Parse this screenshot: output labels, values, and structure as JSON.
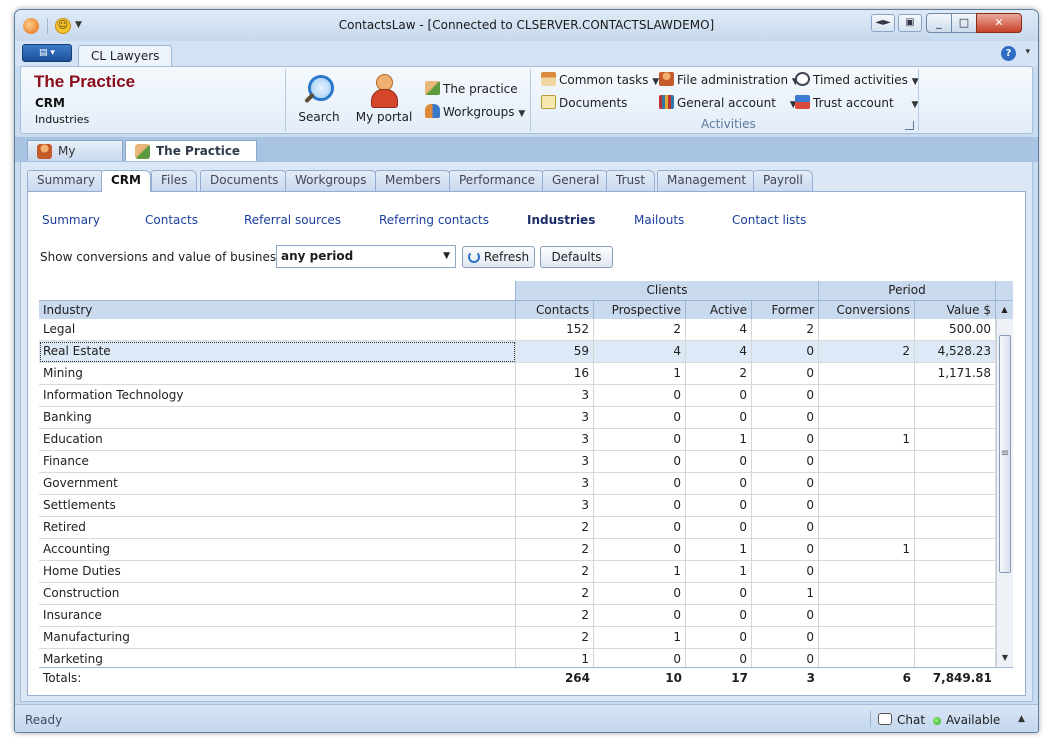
{
  "window": {
    "title": "ContactsLaw - [Connected to CLSERVER.CONTACTSLAWDEMO]"
  },
  "ribbon_tabs": {
    "active": "CL Lawyers"
  },
  "context": {
    "title": "The Practice",
    "module": "CRM",
    "section": "Industries"
  },
  "ribbon": {
    "search_label": "Search",
    "my_portal_label": "My portal",
    "the_practice_label": "The practice",
    "workgroups_label": "Workgroups",
    "common_tasks_label": "Common tasks",
    "documents_label": "Documents",
    "file_admin_label": "File administration",
    "general_account_label": "General account",
    "timed_activities_label": "Timed activities",
    "trust_account_label": "Trust account",
    "activities_group_label": "Activities"
  },
  "doc_tabs": [
    {
      "label": "My portal"
    },
    {
      "label": "The Practice"
    }
  ],
  "module_tabs": [
    "Summary",
    "CRM",
    "Files",
    "Documents",
    "Workgroups",
    "Members",
    "Performance",
    "General",
    "Trust",
    "Management",
    "Payroll"
  ],
  "sub_nav": [
    "Summary",
    "Contacts",
    "Referral sources",
    "Referring contacts",
    "Industries",
    "Mailouts",
    "Contact lists"
  ],
  "filter": {
    "label": "Show conversions and value of business for",
    "period": "any period",
    "refresh_label": "Refresh",
    "defaults_label": "Defaults"
  },
  "grid": {
    "bands": {
      "clients": "Clients",
      "period": "Period"
    },
    "columns": {
      "industry": "Industry",
      "contacts": "Contacts",
      "prospective": "Prospective",
      "active": "Active",
      "former": "Former",
      "conversions": "Conversions",
      "value": "Value $"
    },
    "rows": [
      {
        "industry": "Legal",
        "contacts": "152",
        "prospective": "2",
        "active": "4",
        "former": "2",
        "conversions": "",
        "value": "500.00"
      },
      {
        "industry": "Real Estate",
        "contacts": "59",
        "prospective": "4",
        "active": "4",
        "former": "0",
        "conversions": "2",
        "value": "4,528.23"
      },
      {
        "industry": "Mining",
        "contacts": "16",
        "prospective": "1",
        "active": "2",
        "former": "0",
        "conversions": "",
        "value": "1,171.58"
      },
      {
        "industry": "Information Technology",
        "contacts": "3",
        "prospective": "0",
        "active": "0",
        "former": "0",
        "conversions": "",
        "value": ""
      },
      {
        "industry": "Banking",
        "contacts": "3",
        "prospective": "0",
        "active": "0",
        "former": "0",
        "conversions": "",
        "value": ""
      },
      {
        "industry": "Education",
        "contacts": "3",
        "prospective": "0",
        "active": "1",
        "former": "0",
        "conversions": "1",
        "value": ""
      },
      {
        "industry": "Finance",
        "contacts": "3",
        "prospective": "0",
        "active": "0",
        "former": "0",
        "conversions": "",
        "value": ""
      },
      {
        "industry": "Government",
        "contacts": "3",
        "prospective": "0",
        "active": "0",
        "former": "0",
        "conversions": "",
        "value": ""
      },
      {
        "industry": "Settlements",
        "contacts": "3",
        "prospective": "0",
        "active": "0",
        "former": "0",
        "conversions": "",
        "value": ""
      },
      {
        "industry": "Retired",
        "contacts": "2",
        "prospective": "0",
        "active": "0",
        "former": "0",
        "conversions": "",
        "value": ""
      },
      {
        "industry": "Accounting",
        "contacts": "2",
        "prospective": "0",
        "active": "1",
        "former": "0",
        "conversions": "1",
        "value": ""
      },
      {
        "industry": "Home Duties",
        "contacts": "2",
        "prospective": "1",
        "active": "1",
        "former": "0",
        "conversions": "",
        "value": ""
      },
      {
        "industry": "Construction",
        "contacts": "2",
        "prospective": "0",
        "active": "0",
        "former": "1",
        "conversions": "",
        "value": ""
      },
      {
        "industry": "Insurance",
        "contacts": "2",
        "prospective": "0",
        "active": "0",
        "former": "0",
        "conversions": "",
        "value": ""
      },
      {
        "industry": "Manufacturing",
        "contacts": "2",
        "prospective": "1",
        "active": "0",
        "former": "0",
        "conversions": "",
        "value": ""
      },
      {
        "industry": "Marketing",
        "contacts": "1",
        "prospective": "0",
        "active": "0",
        "former": "0",
        "conversions": "",
        "value": ""
      }
    ],
    "selected_row": "Real Estate",
    "totals": {
      "label": "Totals:",
      "contacts": "264",
      "prospective": "10",
      "active": "17",
      "former": "3",
      "conversions": "6",
      "value": "7,849.81"
    }
  },
  "statusbar": {
    "status": "Ready",
    "chat_label": "Chat",
    "availability": "Available"
  },
  "colors": {
    "context_title": "#8b0c1a",
    "link": "#1a3f9c",
    "header_band": "#c9d9ee",
    "selection": "#dde9f7"
  },
  "icons": [
    "app-icon",
    "smiley-icon",
    "search-icon",
    "person-icon",
    "handshake-icon",
    "group-icon",
    "house-icon",
    "document-icon",
    "books-icon",
    "clock-icon",
    "cheque-icon",
    "help-icon",
    "refresh-icon",
    "chat-icon",
    "status-dot-icon"
  ]
}
